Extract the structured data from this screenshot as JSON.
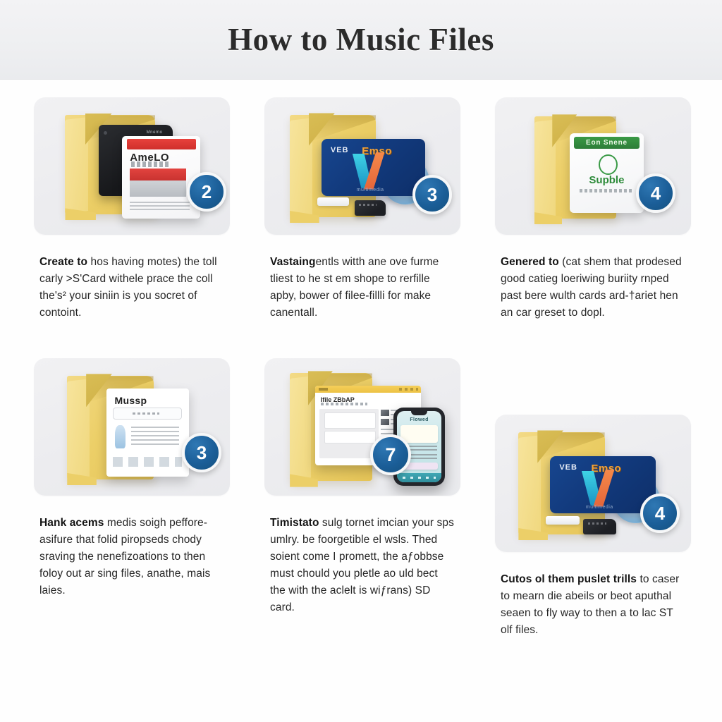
{
  "header": {
    "title": "How to Music Files"
  },
  "steps": [
    {
      "badge": "2",
      "caption_lead": "Create to",
      "caption_rest": " hos having motes) the toll carly >S'Card withele prace the coll the's² your siniin is you socret of contoint.",
      "illustration": {
        "type": "folder-with-product-box",
        "folder_color": "#eccf68",
        "box_title": "AmeLO",
        "accent_color": "#d83a35"
      }
    },
    {
      "badge": "3",
      "caption_lead": "Vastaing",
      "caption_rest": "entls witth ane ove furme tliest to he st em shope to rerfille apby, bower of filee-fillli for make canentall.",
      "illustration": {
        "type": "folder-with-blue-media-card",
        "folder_color": "#eccf68",
        "card_label": "VEB",
        "card_brand": "Emso",
        "card_footnote": "multimedia",
        "accent_color": "#17468f"
      }
    },
    {
      "badge": "4",
      "caption_lead": "Genered to",
      "caption_rest": " (cat shem that prodesed good catieg loeriwing buriity rnped past bere wulth cards ard-†ariet hen an car greset to dopl.",
      "illustration": {
        "type": "folder-with-green-software-box",
        "folder_color": "#eccf68",
        "box_header": "Eon Snene",
        "box_name": "Supble",
        "accent_color": "#2d8b3a"
      }
    },
    {
      "badge": "3",
      "caption_lead": "Hank acems",
      "caption_rest": " medis soigh peffore-asifure that folid piropseds chody sraving the nenefizoations to then foloy out ar sing files, anathe, mais laies.",
      "illustration": {
        "type": "folder-with-document-sheet",
        "folder_color": "#eccf68",
        "sheet_title": "Mussp",
        "accent_color": "#9cc3e2"
      }
    },
    {
      "badge": "7",
      "caption_lead": "Timistato",
      "caption_rest": " sulg tornet imcian your sps umlry. be foorgetible el wsls. Thed soient come I promett, the aƒobbse must chould you pletle ao uld bect the with the aclelt is wiƒrans) SD card.",
      "illustration": {
        "type": "folder-with-browser-and-phone",
        "folder_color": "#eccf68",
        "browser_title": "Ifile ZBbAP",
        "accent_color": "#3fa7b4"
      }
    },
    {
      "badge": "4",
      "caption_lead": "Cutos ol them puslet trills",
      "caption_rest": " to caser to mearn die abeils or beot aputhal seaen to fly way to then a to lac ST olf files.",
      "illustration": {
        "type": "folder-with-blue-media-card",
        "folder_color": "#eccf68",
        "card_label": "VEB",
        "card_brand": "Emso",
        "card_footnote": "multimedia",
        "accent_color": "#17468f"
      }
    }
  ],
  "theme": {
    "background": "#fefefe",
    "header_background": "#eeeff1",
    "tile_background": "#ececef",
    "badge_color": "#1b5e98",
    "text_color": "#262626"
  }
}
